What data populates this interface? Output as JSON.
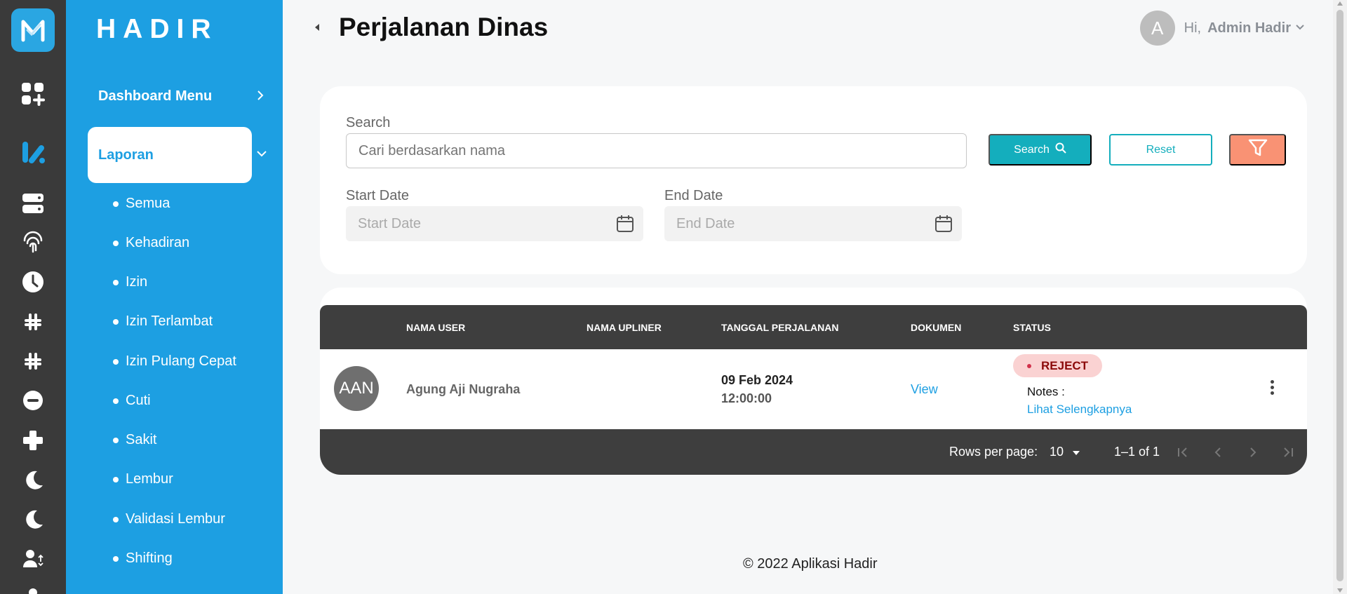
{
  "brand": "HADIR",
  "colors": {
    "sidebar": "#1d9fe2",
    "rail": "#3a3a3a",
    "accent": "#14aebd",
    "filter": "#f99274",
    "table_header": "#3e3e3e",
    "reject_bg": "#fad2d2",
    "reject_text": "#8b0a0a"
  },
  "rail_icons": [
    "grid-plus-icon",
    "reports-icon",
    "server-icon",
    "fingerprint-icon",
    "clock-icon",
    "slack-icon",
    "slack-icon-2",
    "minus-circle-icon",
    "plus-icon",
    "moon-icon",
    "moon-icon-2",
    "user-swap-icon",
    "user-icon"
  ],
  "sidebar": {
    "dashboard_label": "Dashboard Menu",
    "laporan_label": "Laporan",
    "items": [
      "Semua",
      "Kehadiran",
      "Izin",
      "Izin Terlambat",
      "Izin Pulang Cepat",
      "Cuti",
      "Sakit",
      "Lembur",
      "Validasi Lembur",
      "Shifting"
    ]
  },
  "header": {
    "title": "Perjalanan Dinas",
    "avatar_letter": "A",
    "greeting": "Hi,",
    "user_name": "Admin Hadir"
  },
  "filters": {
    "search_label": "Search",
    "search_placeholder": "Cari berdasarkan nama",
    "search_button": "Search",
    "reset_button": "Reset",
    "start_label": "Start Date",
    "start_placeholder": "Start Date",
    "end_label": "End Date",
    "end_placeholder": "End Date"
  },
  "table": {
    "columns": [
      "NAMA USER",
      "NAMA UPLINER",
      "TANGGAL PERJALANAN",
      "DOKUMEN",
      "STATUS"
    ],
    "rows": [
      {
        "initials": "AAN",
        "name": "Agung Aji Nugraha",
        "upliner": "",
        "date": "09 Feb 2024",
        "time": "12:00:00",
        "document": "View",
        "status": "REJECT",
        "notes_label": "Notes :",
        "notes_link": "Lihat Selengkapnya"
      }
    ],
    "rows_per_page_label": "Rows per page:",
    "rows_per_page": "10",
    "range": "1–1 of 1"
  },
  "footer": "© 2022 Aplikasi Hadir"
}
